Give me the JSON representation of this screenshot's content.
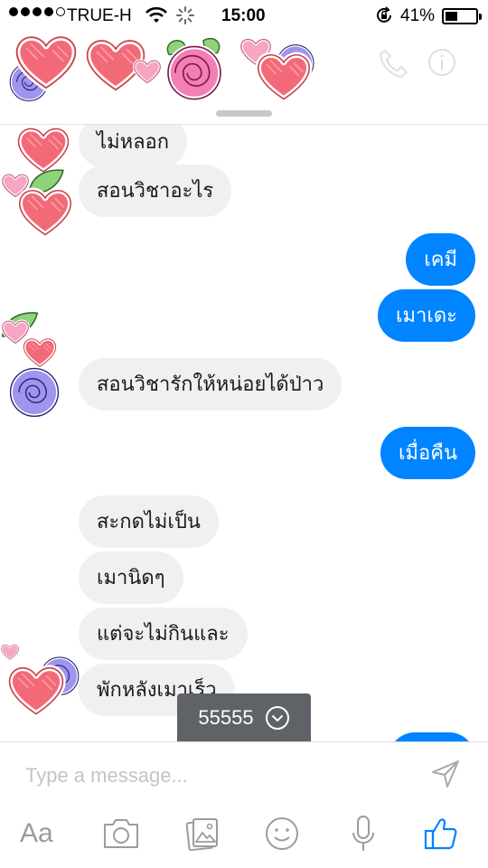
{
  "status_bar": {
    "carrier": "TRUE-H",
    "time": "15:00",
    "battery_percent": "41%",
    "battery_level": 0.41
  },
  "messages": [
    {
      "side": "in",
      "text": "ไม่หลอก"
    },
    {
      "side": "in",
      "text": "สอนวิชาอะไร"
    },
    {
      "side": "out",
      "text": "เคมี"
    },
    {
      "side": "out",
      "text": "เมาเดะ"
    },
    {
      "side": "in",
      "text": "สอนวิชารักให้หน่อยได้ป่าว"
    },
    {
      "side": "out",
      "text": "เมื่อคืน"
    },
    {
      "side": "in",
      "text": "สะกดไม่เป็น"
    },
    {
      "side": "in",
      "text": "เมานิดๆ"
    },
    {
      "side": "in",
      "text": "แต่จะไม่กินและ"
    },
    {
      "side": "in",
      "text": "พักหลังเมาเร็ว"
    }
  ],
  "new_message_toast": {
    "text": "55555",
    "icon": "chevron-down-circle-icon"
  },
  "composer": {
    "placeholder": "Type a message...",
    "send_icon": "send-arrow-icon",
    "toolbar": {
      "text_label": "Aa",
      "icons": [
        "camera-icon",
        "gallery-icon",
        "emoji-icon",
        "microphone-icon",
        "like-thumb-icon"
      ]
    }
  },
  "colors": {
    "outgoing_bubble": "#0084ff",
    "incoming_bubble": "#f1f0f0",
    "like_accent": "#0084ff",
    "toast_bg": "#5f6368"
  }
}
